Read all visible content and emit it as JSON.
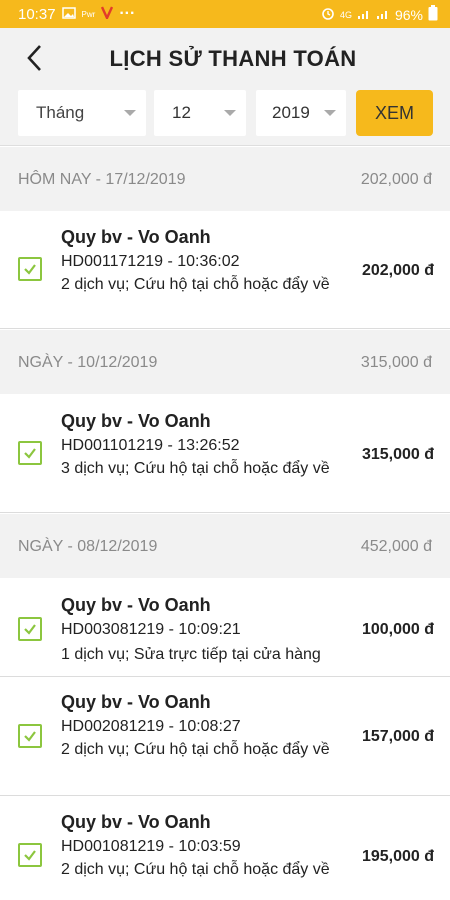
{
  "status_bar": {
    "time": "10:37",
    "left_icons": [
      "image-icon",
      "pwr-icon",
      "vpn-icon",
      "more-dots-icon"
    ],
    "left_texts": {
      "pwr": "Pwr",
      "more": "···"
    },
    "right_icons": [
      "alarm-icon",
      "lte-icon",
      "signal-icon",
      "signal-icon",
      "battery-icon"
    ],
    "network": "4G",
    "battery": "96%"
  },
  "header": {
    "title": "LỊCH SỬ THANH TOÁN"
  },
  "filters": {
    "month_label": "Tháng",
    "day_value": "12",
    "year_value": "2019",
    "view_button": "XEM"
  },
  "groups": [
    {
      "date_label": "HÔM NAY -  17/12/2019",
      "total": "202,000 đ",
      "items": [
        {
          "name": "Quy bv - Vo Oanh",
          "code": "HD001171219 - 10:36:02",
          "desc": "2 dịch vụ;  Cứu hộ tại chỗ hoặc đẩy về",
          "amount": "202,000 đ"
        }
      ]
    },
    {
      "date_label": "NGÀY -  10/12/2019",
      "total": "315,000 đ",
      "items": [
        {
          "name": "Quy bv - Vo Oanh",
          "code": "HD001101219 - 13:26:52",
          "desc": "3 dịch vụ;  Cứu hộ tại chỗ hoặc đẩy về",
          "amount": "315,000 đ"
        }
      ]
    },
    {
      "date_label": "NGÀY -  08/12/2019",
      "total": "452,000 đ",
      "items": [
        {
          "name": "Quy bv - Vo Oanh",
          "code": "HD003081219 - 10:09:21",
          "desc": "1 dịch vụ;  Sửa trực tiếp tại cửa hàng",
          "amount": "100,000 đ"
        },
        {
          "name": "Quy bv - Vo Oanh",
          "code": "HD002081219 - 10:08:27",
          "desc": "2 dịch vụ;  Cứu hộ tại chỗ hoặc đẩy về",
          "amount": "157,000 đ"
        },
        {
          "name": "Quy bv - Vo Oanh",
          "code": "HD001081219 - 10:03:59",
          "desc": "2 dịch vụ;  Cứu hộ tại chỗ hoặc đẩy về",
          "amount": "195,000 đ"
        }
      ]
    }
  ],
  "colors": {
    "accent": "#f6b91c",
    "check_green": "#8cc63f",
    "header_gray": "#8a8a8a"
  }
}
